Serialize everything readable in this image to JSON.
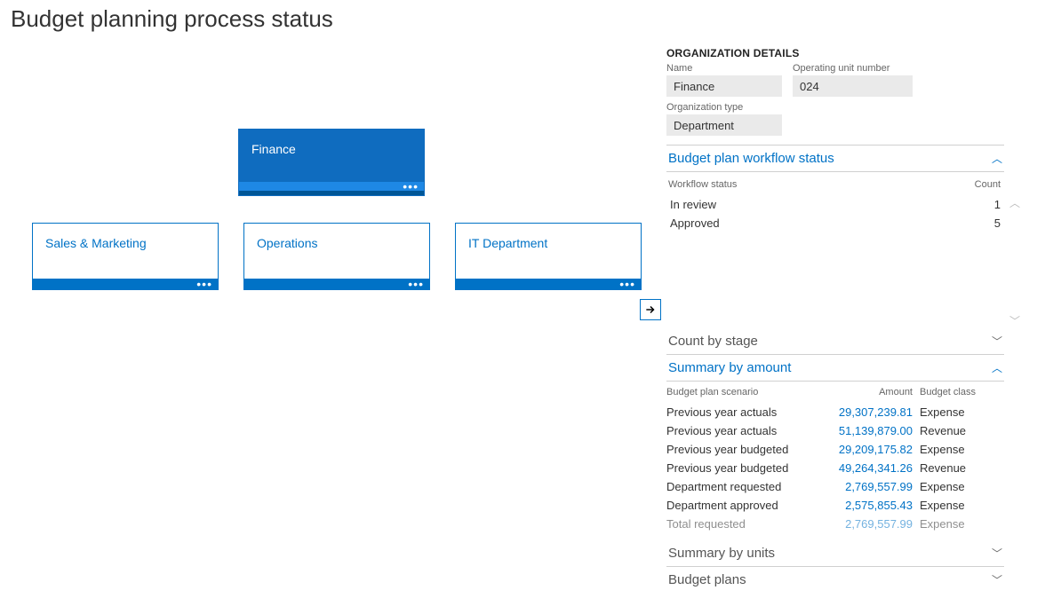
{
  "page": {
    "title": "Budget planning process status"
  },
  "hierarchy": {
    "root": {
      "label": "Finance",
      "selected": true
    },
    "children": [
      {
        "label": "Sales & Marketing"
      },
      {
        "label": "Operations"
      },
      {
        "label": "IT Department"
      }
    ],
    "nav_next_icon": "arrow-right"
  },
  "details": {
    "section_title": "ORGANIZATION DETAILS",
    "fields": {
      "name_label": "Name",
      "name_value": "Finance",
      "unit_label": "Operating unit number",
      "unit_value": "024",
      "type_label": "Organization type",
      "type_value": "Department"
    }
  },
  "workflow_status": {
    "title": "Budget plan workflow status",
    "expanded": true,
    "columns": {
      "status": "Workflow status",
      "count": "Count"
    },
    "rows": [
      {
        "status": "In review",
        "count": "1"
      },
      {
        "status": "Approved",
        "count": "5"
      }
    ]
  },
  "count_by_stage": {
    "title": "Count by stage",
    "expanded": false
  },
  "summary_by_amount": {
    "title": "Summary by amount",
    "expanded": true,
    "columns": {
      "scenario": "Budget plan scenario",
      "amount": "Amount",
      "class": "Budget class"
    },
    "rows": [
      {
        "scenario": "Previous year actuals",
        "amount": "29,307,239.81",
        "class": "Expense"
      },
      {
        "scenario": "Previous year actuals",
        "amount": "51,139,879.00",
        "class": "Revenue"
      },
      {
        "scenario": "Previous year budgeted",
        "amount": "29,209,175.82",
        "class": "Expense"
      },
      {
        "scenario": "Previous year budgeted",
        "amount": "49,264,341.26",
        "class": "Revenue"
      },
      {
        "scenario": "Department requested",
        "amount": "2,769,557.99",
        "class": "Expense"
      },
      {
        "scenario": "Department approved",
        "amount": "2,575,855.43",
        "class": "Expense"
      },
      {
        "scenario": "Total requested",
        "amount": "2,769,557.99",
        "class": "Expense"
      }
    ]
  },
  "summary_by_units": {
    "title": "Summary by units",
    "expanded": false
  },
  "budget_plans": {
    "title": "Budget plans",
    "expanded": false
  }
}
